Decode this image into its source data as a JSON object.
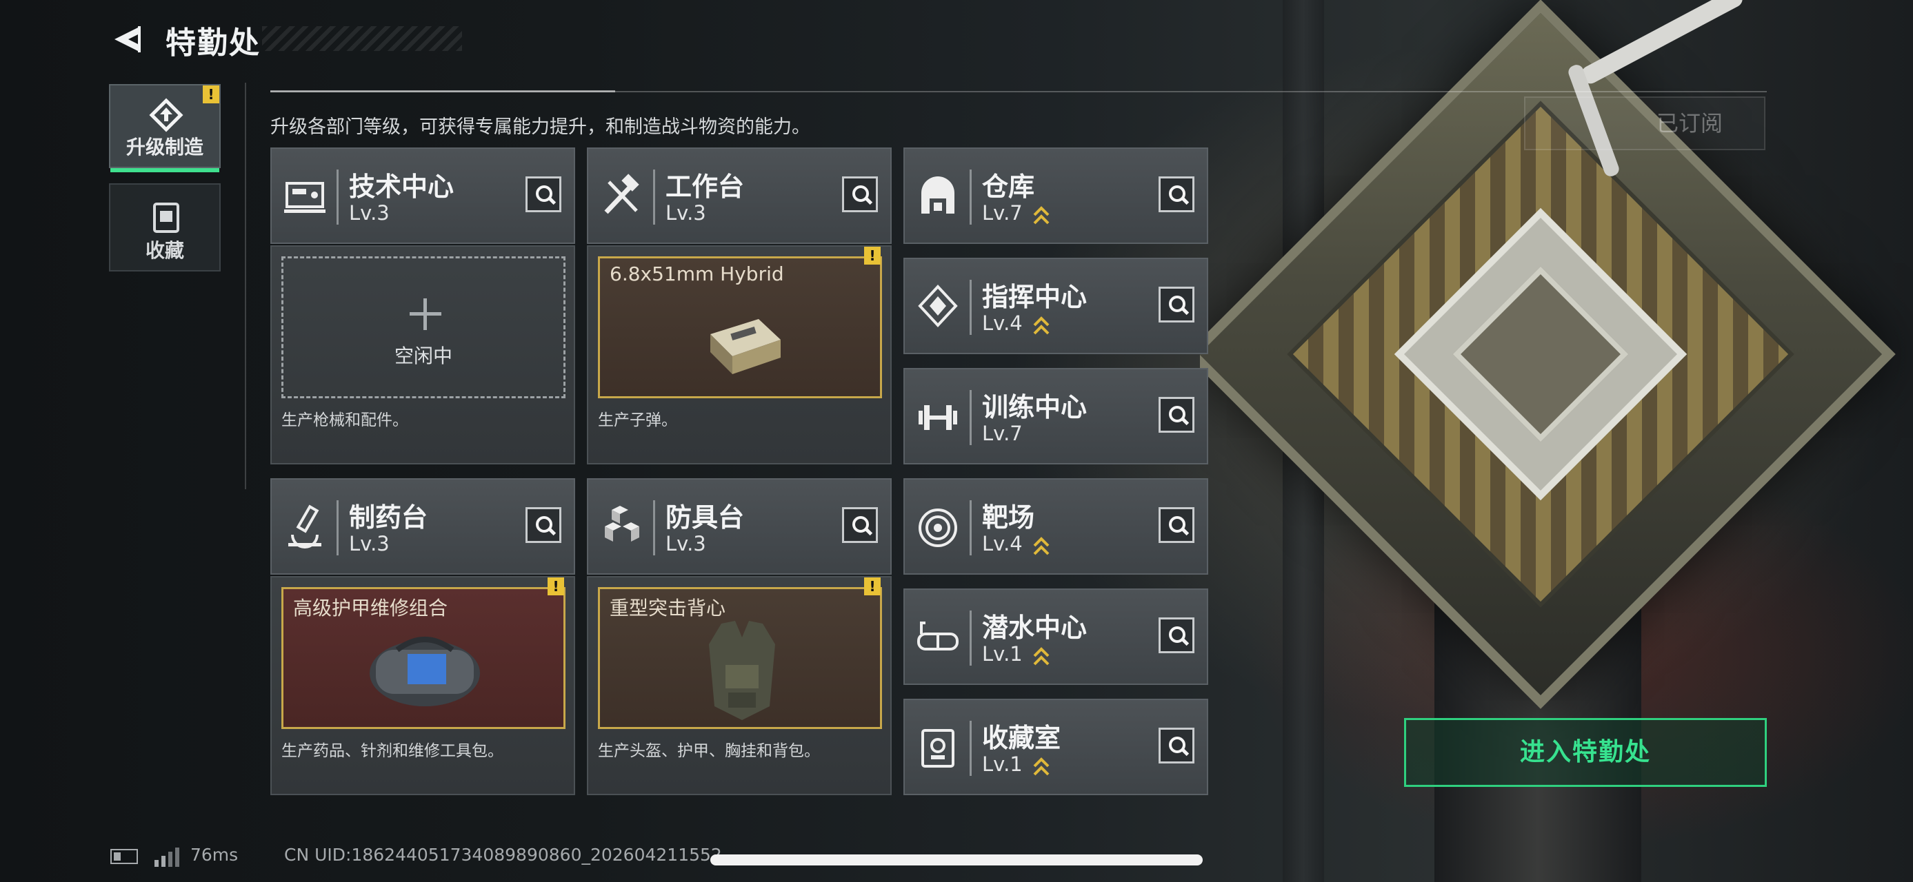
{
  "header": {
    "title": "特勤处",
    "subtitle": "升级各部门等级，可获得专属能力提升，和制造战斗物资的能力。"
  },
  "sidebar": {
    "items": [
      {
        "label": "升级制造",
        "icon": "upgrade-icon",
        "active": true,
        "alert": "!"
      },
      {
        "label": "收藏",
        "icon": "collection-icon",
        "active": false
      }
    ]
  },
  "departments": [
    {
      "name": "技术中心",
      "level": "Lv.3",
      "icon": "tech-center-icon",
      "upgradable": false
    },
    {
      "name": "工作台",
      "level": "Lv.3",
      "icon": "workbench-icon",
      "upgradable": false
    },
    {
      "name": "仓库",
      "level": "Lv.7",
      "icon": "warehouse-icon",
      "upgradable": true
    },
    {
      "name": "指挥中心",
      "level": "Lv.4",
      "icon": "command-center-icon",
      "upgradable": true
    },
    {
      "name": "训练中心",
      "level": "Lv.7",
      "icon": "training-center-icon",
      "upgradable": false
    },
    {
      "name": "制药台",
      "level": "Lv.3",
      "icon": "pharmacy-icon",
      "upgradable": false
    },
    {
      "name": "防具台",
      "level": "Lv.3",
      "icon": "armor-bench-icon",
      "upgradable": false
    },
    {
      "name": "靶场",
      "level": "Lv.4",
      "icon": "shooting-range-icon",
      "upgradable": true
    },
    {
      "name": "潜水中心",
      "level": "Lv.1",
      "icon": "diving-center-icon",
      "upgradable": true
    },
    {
      "name": "收藏室",
      "level": "Lv.1",
      "icon": "collection-room-icon",
      "upgradable": true
    }
  ],
  "production": [
    {
      "slot_state": "empty",
      "item": "",
      "idle_label": "空闲中",
      "desc": "生产枪械和配件。",
      "alert": ""
    },
    {
      "slot_state": "gold",
      "item": "6.8x51mm Hybrid",
      "idle_label": "",
      "desc": "生产子弹。",
      "alert": "!"
    },
    {
      "slot_state": "red",
      "item": "高级护甲维修组合",
      "idle_label": "",
      "desc": "生产药品、针剂和维修工具包。",
      "alert": "!"
    },
    {
      "slot_state": "gold",
      "item": "重型突击背心",
      "idle_label": "",
      "desc": "生产头盔、护甲、胸挂和背包。",
      "alert": "!"
    }
  ],
  "actions": {
    "enter_label": "进入特勤处",
    "subscribed_label": "已订阅"
  },
  "footer": {
    "ping": "76ms",
    "uid": "CN UID:18624405173408989086​0_202604211552"
  },
  "colors": {
    "accent_green": "#2fd07f",
    "alert_yellow": "#e9c236",
    "slot_gold": "#c8a84a"
  }
}
